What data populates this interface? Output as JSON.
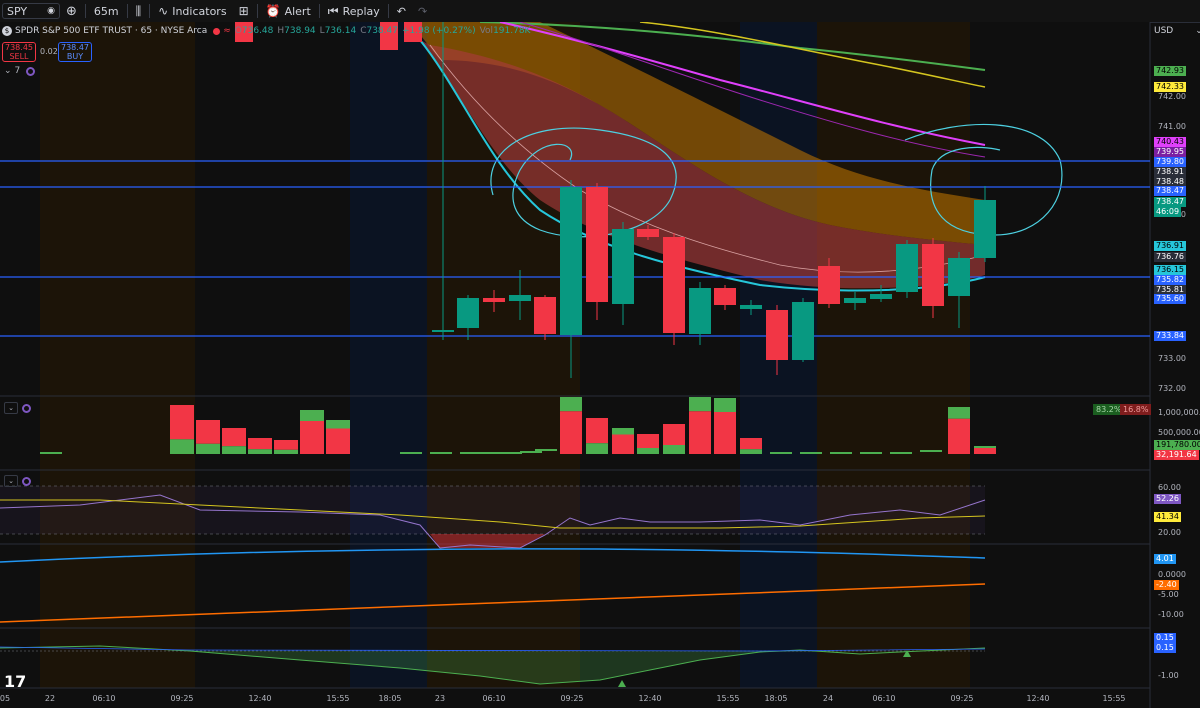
{
  "toolbar": {
    "symbol": "SPY",
    "interval": "65m",
    "indicators_label": "Indicators",
    "alert_label": "Alert",
    "replay_label": "Replay"
  },
  "legend": {
    "title": "SPDR S&P 500 ETF TRUST · 65 · NYSE Arca",
    "open_label": "O",
    "open": "736.48",
    "high_label": "H",
    "high": "738.94",
    "low_label": "L",
    "low": "736.14",
    "close_label": "C",
    "close": "738.47",
    "change": "+1.98 (+0.27%)",
    "vol_label": "Vol",
    "vol": "191.78K"
  },
  "trade": {
    "sell_price": "738.45",
    "sell_label": "SELL",
    "spread": "0.02",
    "buy_price": "738.47",
    "buy_label": "BUY"
  },
  "indicator_count": "7",
  "currency": "USD",
  "price_axis": {
    "ticks": [
      "742.00",
      "741.00",
      "738.00",
      "733.00",
      "732.00"
    ],
    "tags": [
      {
        "text": "742.93",
        "bg": "#4caf50",
        "fg": "#000000"
      },
      {
        "text": "742.33",
        "bg": "#ffeb3b",
        "fg": "#000000"
      },
      {
        "text": "740.43",
        "bg": "#e040fb",
        "fg": "#000000"
      },
      {
        "text": "739.95",
        "bg": "#7b1fa2",
        "fg": "#ffffff"
      },
      {
        "text": "739.80",
        "bg": "#2962ff",
        "fg": "#ffffff"
      },
      {
        "text": "738.91",
        "bg": "#2a2e39",
        "fg": "#ffffff"
      },
      {
        "text": "738.48",
        "bg": "#2a2e39",
        "fg": "#ffffff"
      },
      {
        "text": "738.47",
        "bg": "#2962ff",
        "fg": "#ffffff"
      },
      {
        "text": "738.47",
        "bg": "#089981",
        "fg": "#ffffff"
      },
      {
        "text": "46:09",
        "bg": "#089981",
        "fg": "#ffffff"
      },
      {
        "text": "736.91",
        "bg": "#26c6da",
        "fg": "#000000"
      },
      {
        "text": "736.76",
        "bg": "#2a2e39",
        "fg": "#ffffff"
      },
      {
        "text": "736.15",
        "bg": "#26c6da",
        "fg": "#000000"
      },
      {
        "text": "735.82",
        "bg": "#2962ff",
        "fg": "#ffffff"
      },
      {
        "text": "735.81",
        "bg": "#2a2e39",
        "fg": "#ffffff"
      },
      {
        "text": "735.60",
        "bg": "#2962ff",
        "fg": "#ffffff"
      },
      {
        "text": "733.84",
        "bg": "#2962ff",
        "fg": "#ffffff"
      }
    ]
  },
  "volume_pane": {
    "buy_pct": "83.2%",
    "sell_pct": "16.8%",
    "ticks": [
      "1,000,000.00",
      "500,000.00"
    ],
    "tags": [
      {
        "text": "191,780.00",
        "bg": "#4caf50",
        "fg": "#000000"
      },
      {
        "text": "32,191.64",
        "bg": "#f23645",
        "fg": "#ffffff"
      }
    ]
  },
  "rsi_pane": {
    "ticks": [
      "60.00",
      "20.00"
    ],
    "tags": [
      {
        "text": "52.26",
        "bg": "#7e57c2",
        "fg": "#ffffff"
      },
      {
        "text": "41.34",
        "bg": "#ffeb3b",
        "fg": "#000000"
      }
    ]
  },
  "trend_pane": {
    "ticks": [
      "0.0000",
      "-5.00",
      "-10.00"
    ],
    "tags": [
      {
        "text": "4.01",
        "bg": "#2196f3",
        "fg": "#ffffff"
      },
      {
        "text": "-2.40",
        "bg": "#ff6d00",
        "fg": "#ffffff"
      }
    ]
  },
  "osc_pane": {
    "ticks": [
      "-1.00"
    ],
    "tags": [
      {
        "text": "0.15",
        "bg": "#2962ff",
        "fg": "#ffffff"
      },
      {
        "text": "0.15",
        "bg": "#2962ff",
        "fg": "#ffffff"
      }
    ]
  },
  "time_axis": [
    "05",
    "22",
    "06:10",
    "09:25",
    "12:40",
    "15:55",
    "18:05",
    "23",
    "06:10",
    "09:25",
    "12:40",
    "15:55",
    "18:05",
    "24",
    "06:10",
    "09:25",
    "12:40",
    "15:55"
  ],
  "colors": {
    "up": "#089981",
    "down": "#f23645",
    "hline": "#2962ff",
    "ribbon_orange": "#c77800",
    "ribbon_red": "#8b2d2d"
  }
}
